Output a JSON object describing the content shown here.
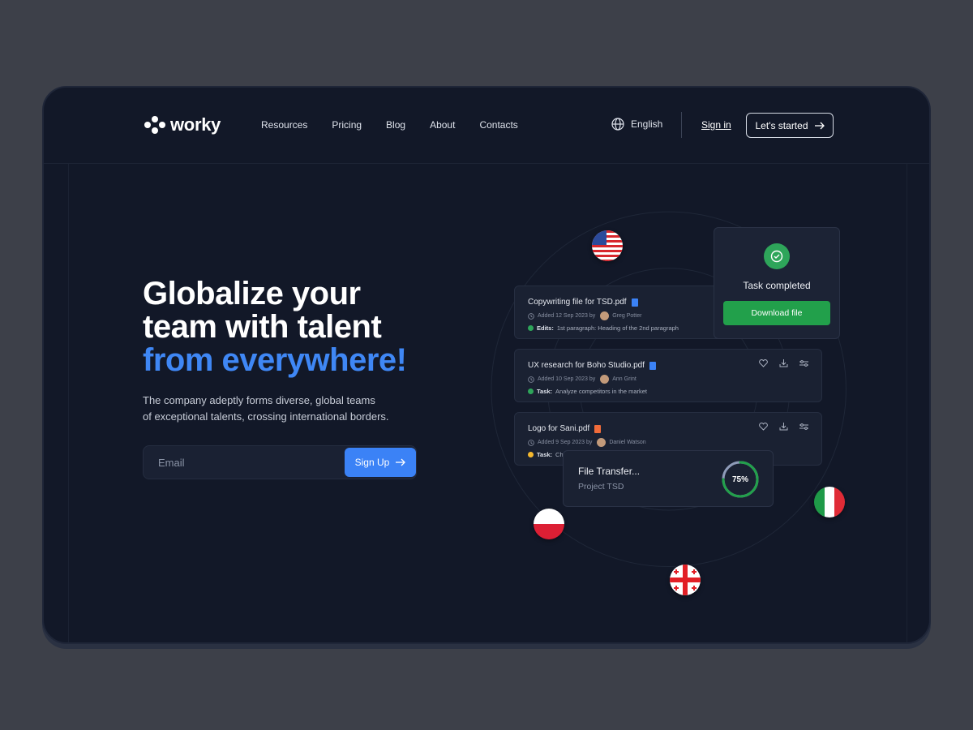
{
  "brand": {
    "name": "worky"
  },
  "nav": {
    "items": [
      "Resources",
      "Pricing",
      "Blog",
      "About",
      "Contacts"
    ]
  },
  "header": {
    "language": "English",
    "signin": "Sign in",
    "cta": "Let's started"
  },
  "hero": {
    "title_line1": "Globalize your",
    "title_line2": "team with talent",
    "title_accent": "from everywhere!",
    "subtitle_line1": "The company adeptly forms diverse, global teams",
    "subtitle_line2": "of exceptional talents, crossing international borders.",
    "email_placeholder": "Email",
    "signup": "Sign Up"
  },
  "cards": [
    {
      "title": "Copywriting file for  TSD.pdf",
      "meta": "Added 12 Sep 2023 by",
      "user": "Greg Potter",
      "task_label": "Edits:",
      "task": "1st paragraph: Heading of the 2nd paragraph",
      "status_color": "#2ea55a",
      "file_color": "#3b82f6"
    },
    {
      "title": "UX research for Boho Studio.pdf",
      "meta": "Added 10 Sep 2023 by",
      "user": "Ann Grint",
      "task_label": "Task:",
      "task": "Analyze competitors in the market",
      "status_color": "#2ea55a",
      "file_color": "#3b82f6"
    },
    {
      "title": "Logo for  Sani.pdf",
      "meta": "Added 9 Sep 2023 by",
      "user": "Daniel Watson",
      "task_label": "Task:",
      "task": "Cha",
      "status_color": "#f5b82e",
      "file_color": "#f06b3a"
    }
  ],
  "task_card": {
    "label": "Task completed",
    "button": "Download file"
  },
  "transfer": {
    "title": "File Transfer...",
    "project": "Project TSD",
    "progress": 0.75,
    "progress_label": "75%"
  },
  "flags": [
    "us-flag",
    "poland-flag",
    "georgia-flag",
    "italy-flag"
  ],
  "colors": {
    "accent": "#3f87f5",
    "success": "#22a04b",
    "background": "#121828"
  }
}
